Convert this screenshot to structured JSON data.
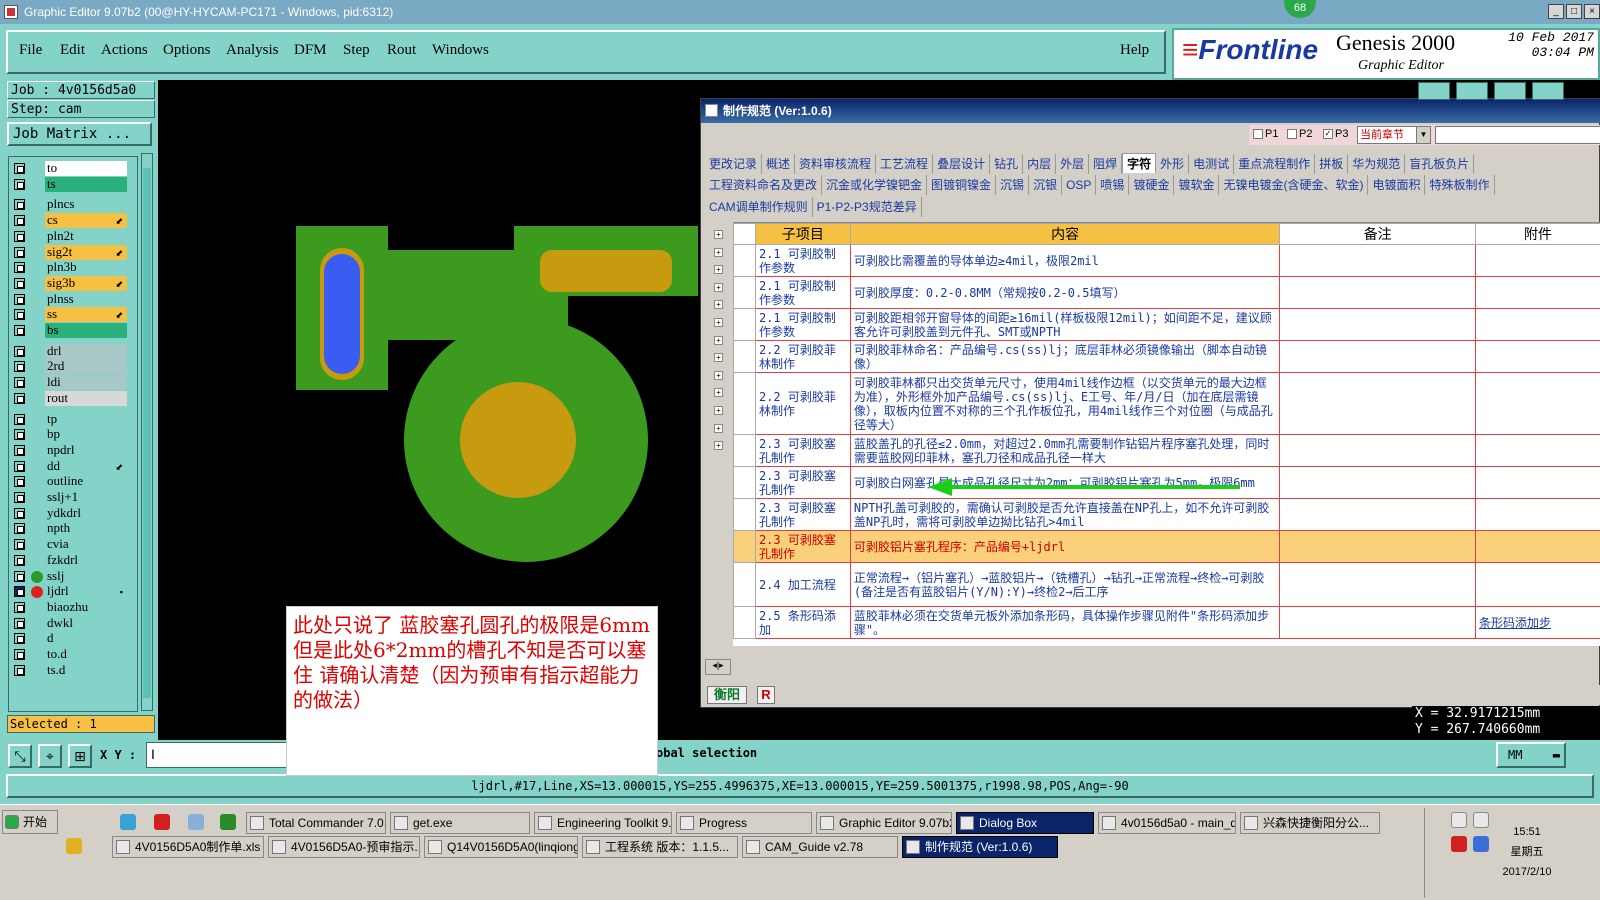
{
  "window": {
    "title": "Graphic Editor 9.07b2 (00@HY-HYCAM-PC171 - Windows, pid:6312)",
    "badge": "68"
  },
  "menu": [
    "File",
    "Edit",
    "Actions",
    "Options",
    "Analysis",
    "DFM",
    "Step",
    "Rout",
    "Windows"
  ],
  "help": "Help",
  "brand": {
    "logo": "Frontline",
    "product": "Genesis 2000",
    "sub": "Graphic Editor",
    "date": "10 Feb 2017",
    "time": "03:04 PM"
  },
  "job": {
    "job": "Job : 4v0156d5a0",
    "step": "Step: cam",
    "matrix": "Job Matrix ..."
  },
  "layers": [
    {
      "name": "to",
      "color": "#ffffff",
      "arrow": ""
    },
    {
      "name": "ts",
      "color": "#2ab07a",
      "arrow": ""
    },
    {
      "name": "plncs",
      "color": "#83d3c9",
      "arrow": ""
    },
    {
      "name": "cs",
      "color": "#f5c044",
      "arrow": "⬋"
    },
    {
      "name": "pln2t",
      "color": "#83d3c9",
      "arrow": ""
    },
    {
      "name": "sig2t",
      "color": "#f5c044",
      "arrow": "⬋"
    },
    {
      "name": "pln3b",
      "color": "#83d3c9",
      "arrow": ""
    },
    {
      "name": "sig3b",
      "color": "#f5c044",
      "arrow": "⬋"
    },
    {
      "name": "plnss",
      "color": "#83d3c9",
      "arrow": ""
    },
    {
      "name": "ss",
      "color": "#f5c044",
      "arrow": "⬋"
    },
    {
      "name": "bs",
      "color": "#2ab07a",
      "arrow": ""
    },
    {
      "name": "drl",
      "color": "#a8c8c8",
      "arrow": ""
    },
    {
      "name": "2rd",
      "color": "#a8c8c8",
      "arrow": ""
    },
    {
      "name": "ldi",
      "color": "#a8c8c8",
      "arrow": ""
    },
    {
      "name": "rout",
      "color": "#d8d8d8",
      "arrow": ""
    },
    {
      "name": "tp",
      "color": "#83d3c9",
      "arrow": ""
    },
    {
      "name": "bp",
      "color": "#83d3c9",
      "arrow": ""
    },
    {
      "name": "npdrl",
      "color": "#83d3c9",
      "arrow": ""
    },
    {
      "name": "dd",
      "color": "#83d3c9",
      "arrow": "⬋"
    },
    {
      "name": "outline",
      "color": "#83d3c9",
      "arrow": ""
    },
    {
      "name": "sslj+1",
      "color": "#83d3c9",
      "arrow": ""
    },
    {
      "name": "ydkdrl",
      "color": "#83d3c9",
      "arrow": ""
    },
    {
      "name": "npth",
      "color": "#83d3c9",
      "arrow": ""
    },
    {
      "name": "cvia",
      "color": "#83d3c9",
      "arrow": ""
    },
    {
      "name": "fzkdrl",
      "color": "#83d3c9",
      "arrow": ""
    },
    {
      "name": "sslj",
      "color": "#83d3c9",
      "arrow": ""
    },
    {
      "name": "ljdrl",
      "color": "#83d3c9",
      "arrow": "▪"
    },
    {
      "name": "biaozhu",
      "color": "#83d3c9",
      "arrow": ""
    },
    {
      "name": "dwkl",
      "color": "#83d3c9",
      "arrow": ""
    },
    {
      "name": "d",
      "color": "#83d3c9",
      "arrow": ""
    },
    {
      "name": "to.d",
      "color": "#83d3c9",
      "arrow": ""
    },
    {
      "name": "ts.d",
      "color": "#83d3c9",
      "arrow": ""
    }
  ],
  "selected": "Selected : 1",
  "dialog": {
    "title": "制作规范 (Ver:1.0.6)",
    "toolbar": {
      "p1": "P1",
      "p2": "P2",
      "p3": "P3",
      "chapter": "当前章节"
    },
    "tabs1": [
      "更改记录",
      "概述",
      "资料审核流程",
      "工艺流程",
      "叠层设计",
      "钻孔",
      "内层",
      "外层",
      "阻焊",
      "字符",
      "外形",
      "电测试",
      "重点流程制作",
      "拼板",
      "华为规范",
      "盲孔板负片"
    ],
    "tabs2": [
      "工程资料命名及更改",
      "沉金或化学镍钯金",
      "图镀铜镍金",
      "沉锡",
      "沉银",
      "OSP",
      "喷锡",
      "镀硬金",
      "镀软金",
      "无镍电镀金(含硬金、软金)",
      "电镀面积",
      "特殊板制作"
    ],
    "tabs3": [
      "CAM调单制作规则",
      "P1-P2-P3规范差异"
    ],
    "active_tab": "字符",
    "headers": {
      "sub": "子项目",
      "content": "内容",
      "note": "备注",
      "att": "附件"
    },
    "rows": [
      {
        "sub": "2.1 可剥胶制作参数",
        "content": "可剥胶比需覆盖的导体单边≥4mil，极限2mil",
        "att": ""
      },
      {
        "sub": "2.1 可剥胶制作参数",
        "content": "可剥胶厚度：0.2-0.8MM（常规按0.2-0.5填写）",
        "att": ""
      },
      {
        "sub": "2.1 可剥胶制作参数",
        "content": "可剥胶距相邻开窗导体的间距≥16mil(样板极限12mil)；如间距不足，建议顾客允许可剥胶盖到元件孔、SMT或NPTH",
        "att": ""
      },
      {
        "sub": "2.2 可剥胶菲林制作",
        "content": "可剥胶菲林命名：产品编号.cs(ss)lj；底层菲林必须镜像输出（脚本自动镜像）",
        "att": ""
      },
      {
        "sub": "2.2 可剥胶菲林制作",
        "content": "可剥胶菲林都只出交货单元尺寸，使用4mil线作边框（以交货单元的最大边框为准），外形框外加产品编号.cs(ss)lj、E工号、年/月/日（加在底层需镜像），取板内位置不对称的三个孔作板位孔，用4mil线作三个对位圈（与成品孔径等大）",
        "att": ""
      },
      {
        "sub": "2.3 可剥胶塞孔制作",
        "content": "蓝胶盖孔的孔径≤2.0mm，对超过2.0mm孔需要制作钻铝片程序塞孔处理，同时需要蓝胶网印菲林，塞孔刀径和成品孔径一样大",
        "att": ""
      },
      {
        "sub": "2.3 可剥胶塞孔制作",
        "content": "可剥胶白网塞孔最大成品孔径尺寸为2mm；可剥胶铝片塞孔为5mm，极限6mm",
        "att": ""
      },
      {
        "sub": "2.3 可剥胶塞孔制作",
        "content": "NPTH孔盖可剥胶的，需确认可剥胶是否允许直接盖在NP孔上，如不允许可剥胶盖NP孔时，需将可剥胶单边拗比钻孔>4mil",
        "att": ""
      },
      {
        "sub": "2.3 可剥胶塞孔制作",
        "content": "可剥胶铝片塞孔程序：产品编号+ljdrl",
        "att": ""
      },
      {
        "sub": "2.4 加工流程",
        "content": "正常流程→（铝片塞孔）→蓝胶铝片→（铣槽孔）→钻孔→正常流程→终检→可剥胶(备注是否有蓝胶铝片(Y/N):Y)→终检2→后工序",
        "att": ""
      },
      {
        "sub": "2.5 条形码添加",
        "content": "蓝胶菲林必须在交货单元板外添加条形码，具体操作步骤见附件\"条形码添加步骤\"。",
        "att": "条形码添加步"
      }
    ],
    "bottom_tab": "衡阳",
    "bottom_r": "R"
  },
  "coords": {
    "x": "X = 32.9171215mm",
    "y": "Y = 267.740660mm"
  },
  "xy_label": "X Y :",
  "global_selection": "obal selection",
  "units": "MM",
  "status": "ljdrl,#17,Line,XS=13.000015,YS=255.4996375,XE=13.000015,YE=259.5001375,r1998.98,POS,Ang=-90",
  "note": "此处只说了  蓝胶塞孔圆孔的极限是6mm  但是此处6*2mm的槽孔不知是否可以塞住  请确认清楚（因为预审有指示超能力的做法）",
  "taskbar": {
    "start": "开始",
    "row1": [
      "Total Commander 7.0...",
      "get.exe",
      "Engineering Toolkit 9....",
      "Progress",
      "Graphic Editor 9.07b2...",
      "Dialog Box",
      "4v0156d5a0 - main_qa",
      "兴森快捷衡阳分公..."
    ],
    "row2": [
      "4V0156D5A0制作单.xls ...",
      "4V0156D5A0-预审指示....",
      "Q14V0156D5A0(linqiong)...",
      "工程系统  版本：1.1.5...",
      "CAM_Guide v2.78",
      "制作规范 (Ver:1.0.6)"
    ],
    "time": "15:51",
    "weekday": "星期五",
    "date": "2017/2/10"
  }
}
